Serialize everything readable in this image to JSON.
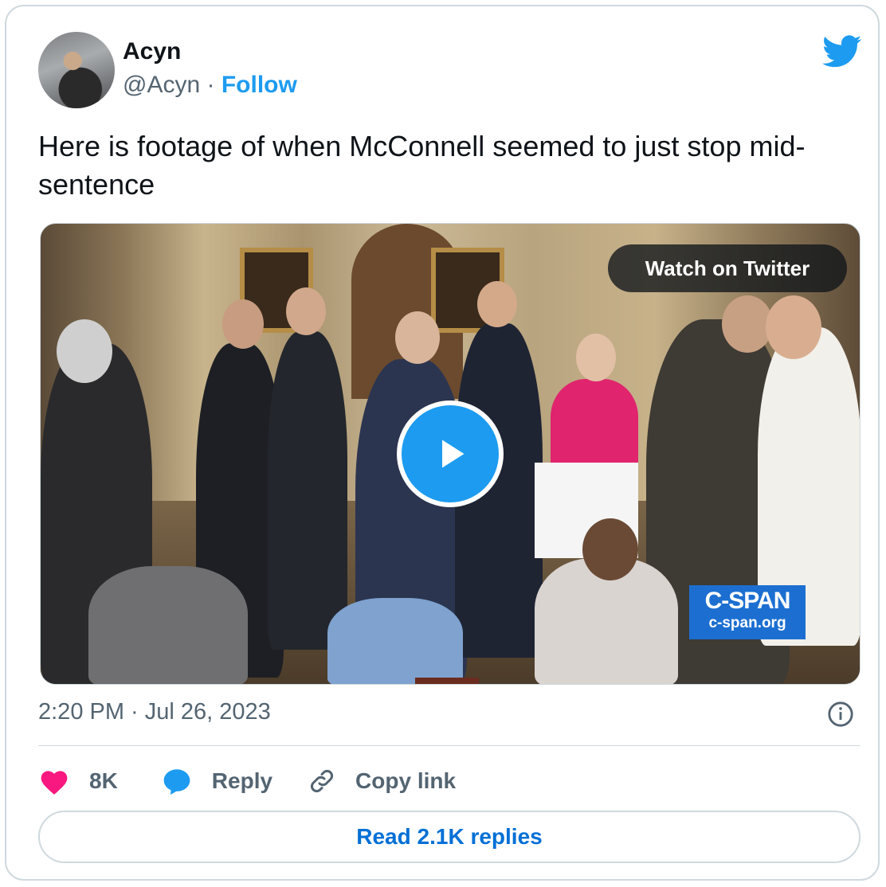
{
  "tweet": {
    "author_name": "Acyn",
    "handle": "@Acyn",
    "separator": "·",
    "follow_label": "Follow",
    "text": "Here is footage of when McConnell seemed to just stop mid-sentence",
    "timestamp": "2:20 PM · Jul 26, 2023"
  },
  "media": {
    "watch_label": "Watch on Twitter",
    "watermark_title": "C-SPAN",
    "watermark_url": "c-span.org"
  },
  "actions": {
    "likes": "8K",
    "reply_label": "Reply",
    "copy_link_label": "Copy link"
  },
  "footer": {
    "read_replies_label": "Read 2.1K replies"
  },
  "colors": {
    "accent": "#1d9bf0",
    "like": "#f91880",
    "muted_text": "#536471",
    "border": "#cfd9de"
  },
  "icons": [
    "twitter-bird-icon",
    "play-icon",
    "heart-icon",
    "reply-icon",
    "link-icon",
    "info-icon"
  ]
}
